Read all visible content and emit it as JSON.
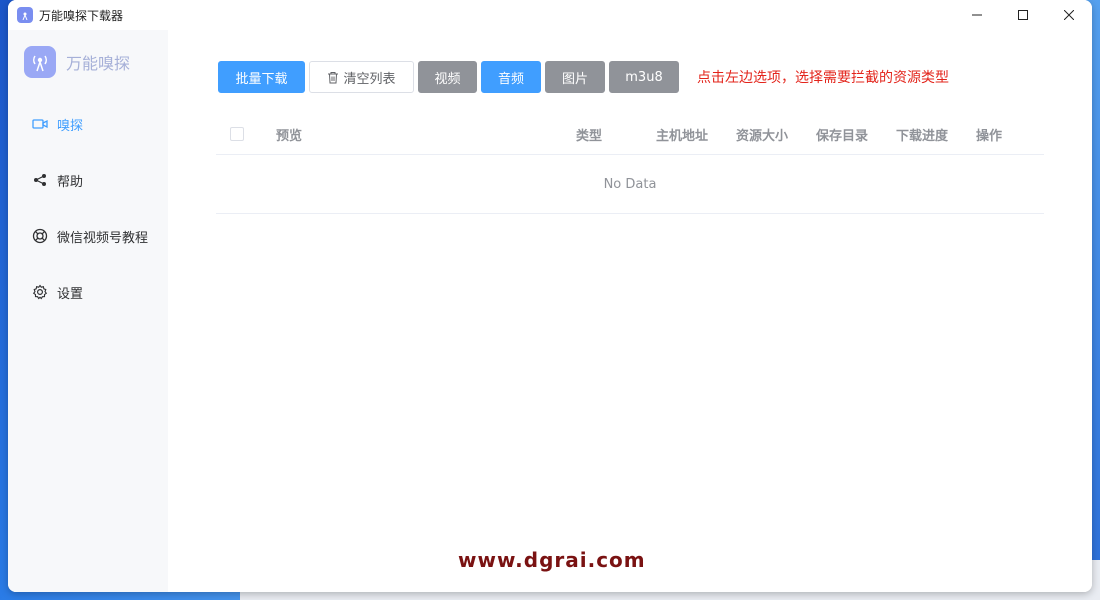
{
  "window": {
    "title": "万能嗅探下载器"
  },
  "brand": {
    "name": "万能嗅探",
    "color": "#9aa8f5"
  },
  "sidebar": {
    "items": [
      {
        "label": "嗅探",
        "icon": "video-camera-icon",
        "active": true
      },
      {
        "label": "帮助",
        "icon": "share-icon",
        "active": false
      },
      {
        "label": "微信视频号教程",
        "icon": "lifebuoy-icon",
        "active": false
      },
      {
        "label": "设置",
        "icon": "gear-icon",
        "active": false
      }
    ]
  },
  "toolbar": {
    "batch_download": "批量下载",
    "clear_list": "清空列表",
    "video": "视频",
    "audio": "音频",
    "image": "图片",
    "m3u8": "m3u8",
    "hint": "点击左边选项，选择需要拦截的资源类型"
  },
  "table": {
    "columns": [
      "预览",
      "类型",
      "主机地址",
      "资源大小",
      "保存目录",
      "下载进度",
      "操作"
    ],
    "empty_text": "No Data"
  },
  "watermark": "www.dgrai.com",
  "colors": {
    "primary": "#409eff",
    "gray": "#909399",
    "hint": "#e3241b"
  }
}
